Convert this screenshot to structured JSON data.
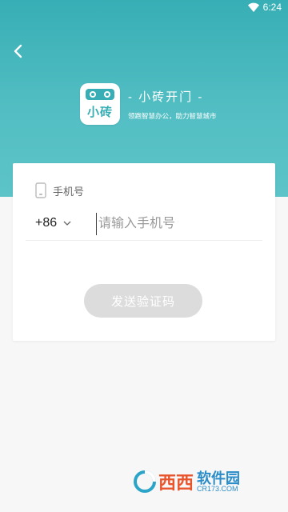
{
  "status_bar": {
    "time": "6:24",
    "wifi_icon": "wifi-icon"
  },
  "header": {
    "back_icon": "chevron-left-icon",
    "logo_mark": "小砖",
    "app_name": "- 小砖开门 -",
    "slogan": "领跑智慧办公，助力智慧城市"
  },
  "form": {
    "phone_label": "手机号",
    "phone_icon": "mobile-phone-icon",
    "country_code": "+86",
    "phone_placeholder": "请输入手机号",
    "phone_value": "",
    "send_button_label": "发送验证码"
  },
  "watermark": {
    "brand": "西西",
    "name": "软件园",
    "url": "CR173.COM"
  },
  "colors": {
    "primary": "#37aeb5",
    "button_disabled": "#dcdcdc",
    "background": "#f7f7f7"
  }
}
